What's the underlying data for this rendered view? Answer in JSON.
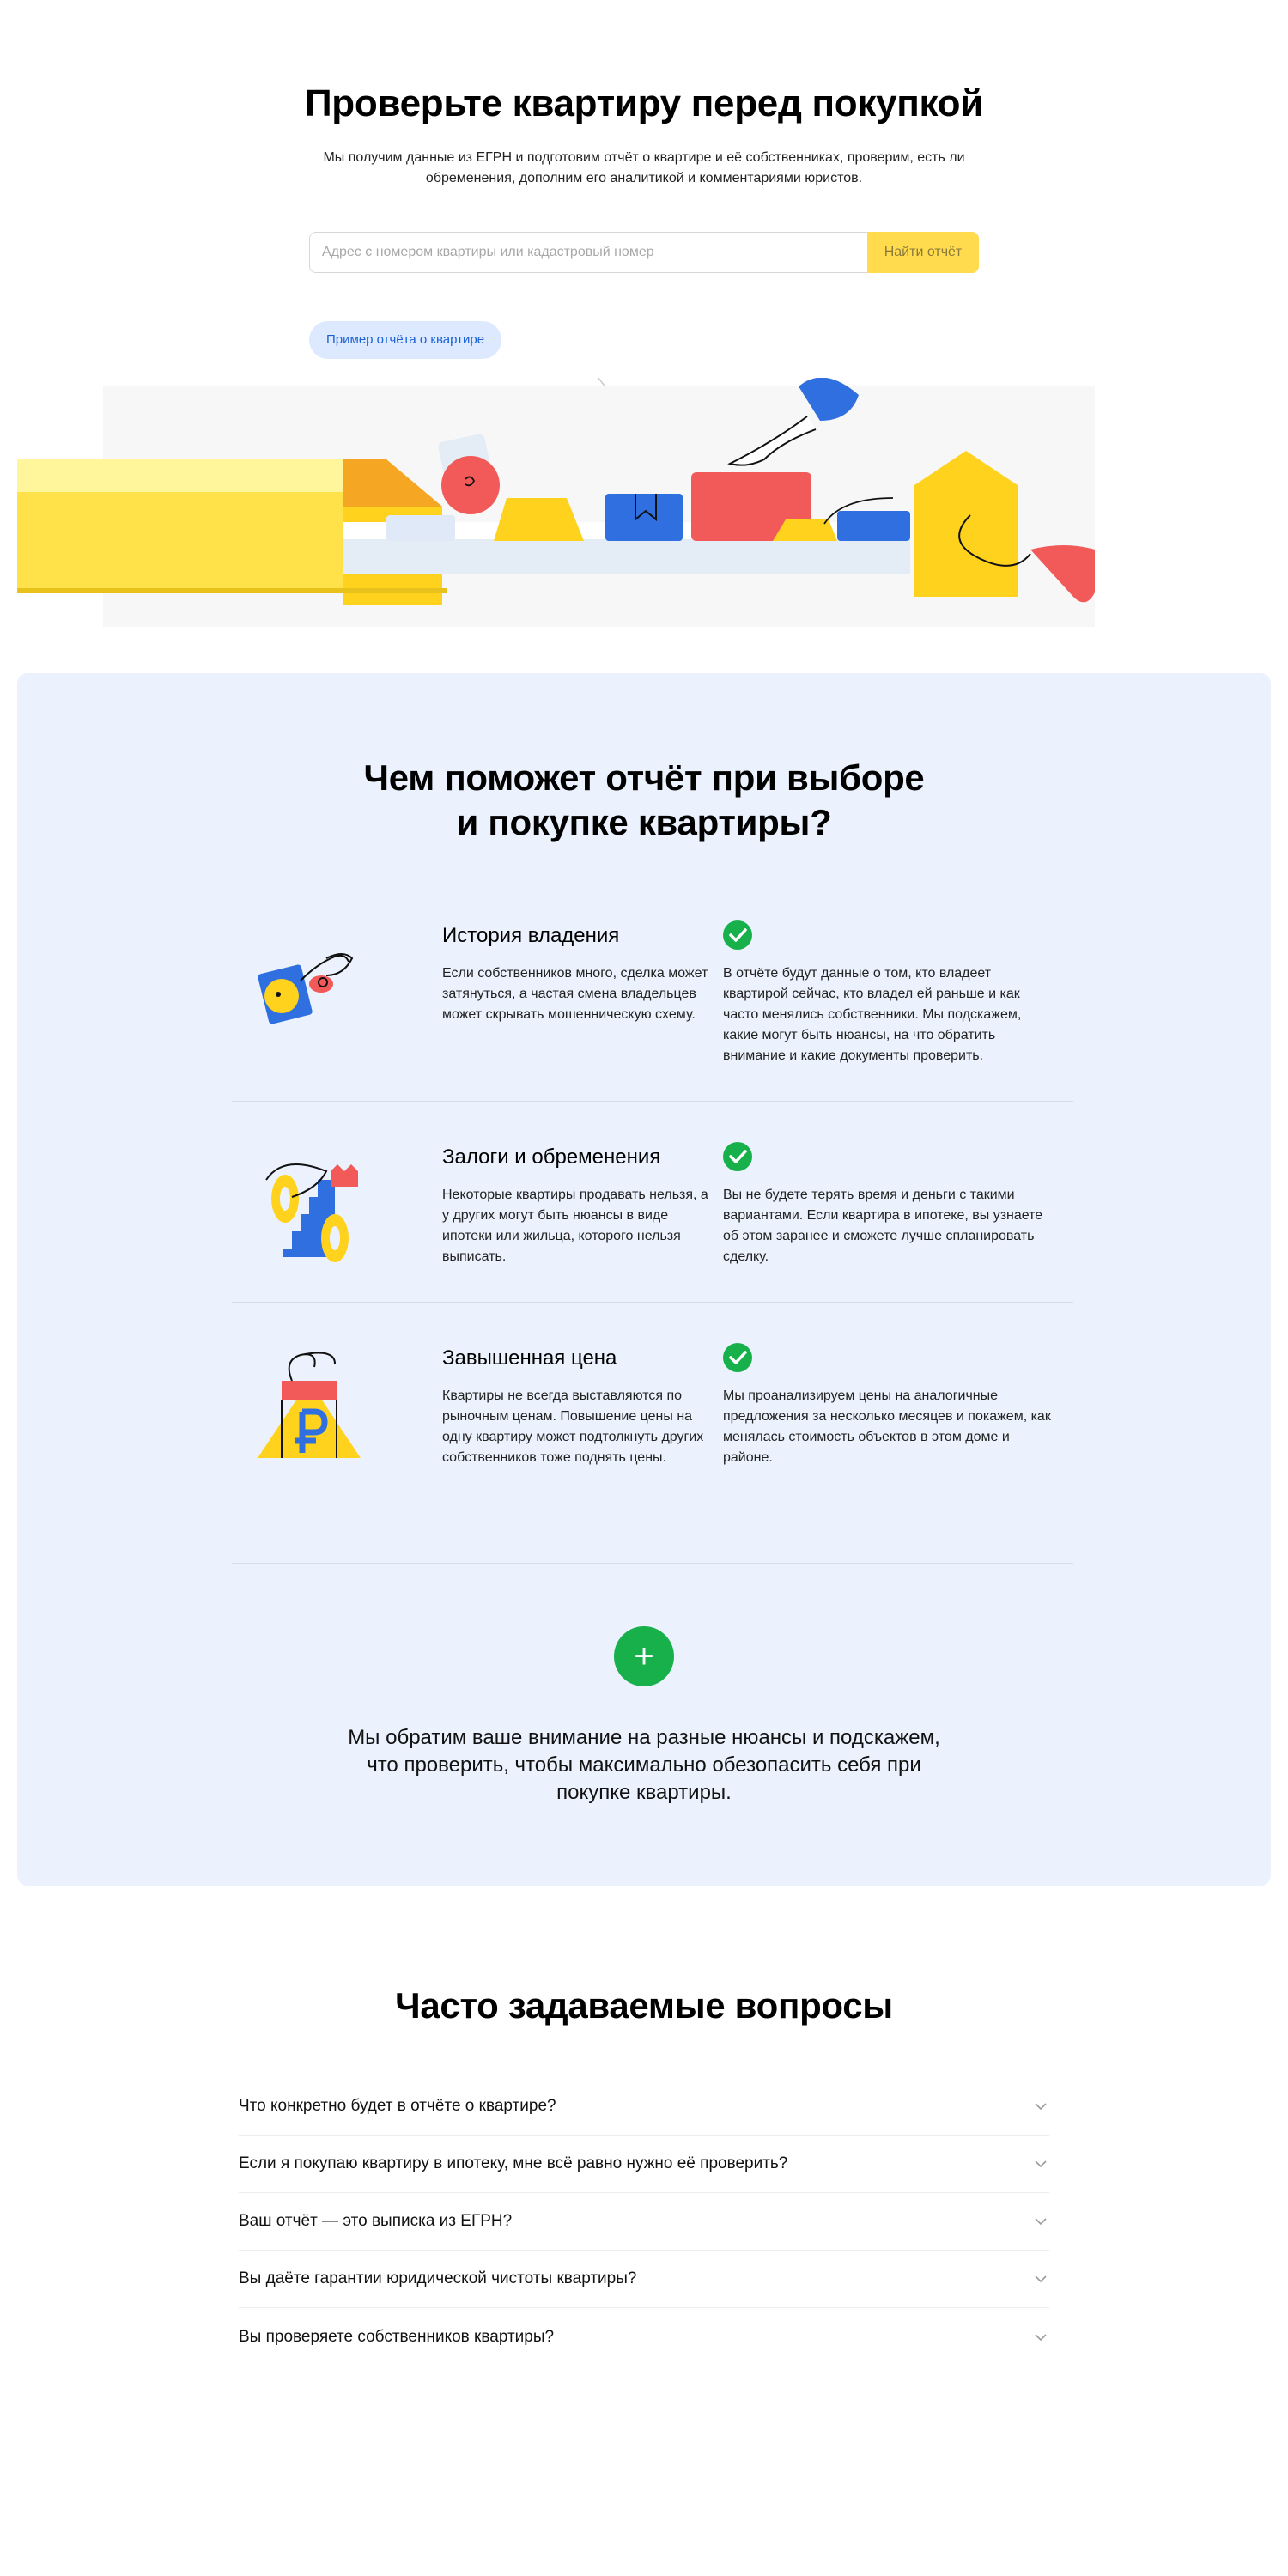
{
  "hero": {
    "title": "Проверьте квартиру перед покупкой",
    "subtitle": "Мы получим данные из ЕГРН и подготовим отчёт о квартире и её собственниках, проверим, есть ли обременения, дополним его аналитикой и комментариями юристов.",
    "search_placeholder": "Адрес с номером квартиры или кадастровый номер",
    "search_button": "Найти отчёт",
    "example_link": "Пример отчёта о квартире"
  },
  "features": {
    "title_line1": "Чем поможет отчёт при выборе",
    "title_line2": "и покупке квартиры?",
    "items": [
      {
        "icon": "key-icon",
        "title": "История владения",
        "problem": "Если собственников много, сделка может затянуться, а частая смена владельцев может скрывать мошенническую схему.",
        "solution": "В отчёте будут данные о том, кто владеет квартирой сейчас, кто владел ей раньше и как часто менялись собственники. Мы подскажем, какие могут быть нюансы, на что обратить внимание и какие документы проверить."
      },
      {
        "icon": "percent-icon",
        "title": "Залоги и обременения",
        "problem": "Некоторые квартиры продавать нельзя, а у других могут быть нюансы в виде ипотеки или жильца, которого нельзя выписать.",
        "solution": "Вы не будете терять время и деньги с такими вариантами. Если квартира в ипотеке, вы узнаете об этом заранее и сможете лучше спланировать сделку."
      },
      {
        "icon": "house-ruble-icon",
        "title": "Завышенная цена",
        "problem": "Квартиры не всегда выставляются по рыночным ценам. Повышение цены на одну квартиру может подтолкнуть других собственников тоже поднять цены.",
        "solution": "Мы проанализируем цены на аналогичные предложения за несколько месяцев и покажем, как менялась стоимость объектов в этом доме и районе."
      }
    ],
    "plus_symbol": "+",
    "bottom_note": "Мы обратим ваше внимание на разные нюансы и подскажем, что проверить, чтобы максимально обезопасить себя при покупке квартиры."
  },
  "faq": {
    "title": "Часто задаваемые вопросы",
    "items": [
      {
        "q": "Что конкретно будет в отчёте о квартире?"
      },
      {
        "q": "Если я покупаю квартиру в ипотеку, мне всё равно нужно её проверить?"
      },
      {
        "q": "Ваш отчёт — это выписка из ЕГРН?"
      },
      {
        "q": "Вы даёте гарантии юридической чистоты квартиры?"
      },
      {
        "q": "Вы проверяете собственников квартиры?"
      }
    ]
  },
  "colors": {
    "accent_yellow": "#ffdb4d",
    "accent_blue": "#1a62d6",
    "panel_bg": "#ebf2fd",
    "success_green": "#18b04a",
    "illu_red": "#f25a5a"
  }
}
